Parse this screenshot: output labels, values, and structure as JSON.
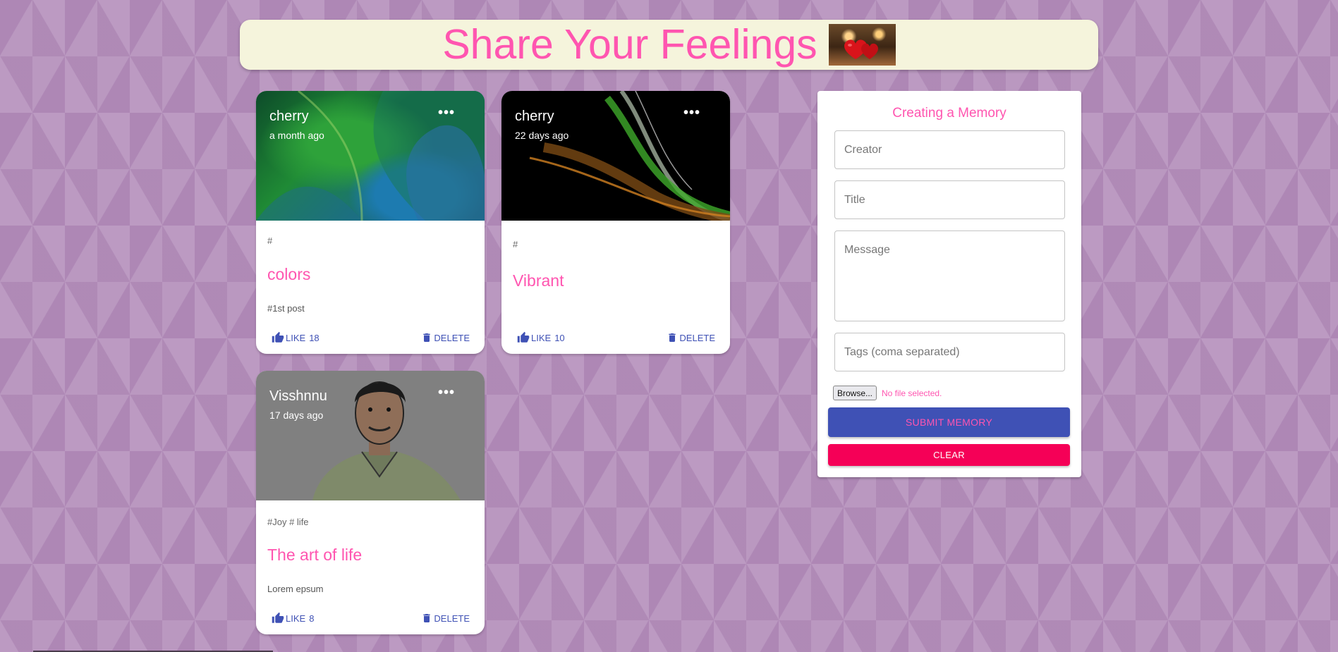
{
  "header": {
    "title": "Share Your Feelings",
    "image_icon": "hearts-image"
  },
  "posts": [
    {
      "author": "cherry",
      "time": "a month ago",
      "tags": "#",
      "title": "colors",
      "message": "#1st post",
      "like_label": "LIKE",
      "like_count": "18",
      "delete_label": "DELETE"
    },
    {
      "author": "cherry",
      "time": "22 days ago",
      "tags": "#",
      "title": "Vibrant",
      "message": "",
      "like_label": "LIKE",
      "like_count": "10",
      "delete_label": "DELETE"
    },
    {
      "author": "Visshnnu",
      "time": "17 days ago",
      "tags": "#Joy # life",
      "title": "The art of life",
      "message": "Lorem epsum",
      "like_label": "LIKE",
      "like_count": "8",
      "delete_label": "DELETE"
    }
  ],
  "form": {
    "title": "Creating a Memory",
    "creator_placeholder": "Creator",
    "title_placeholder": "Title",
    "message_placeholder": "Message",
    "tags_placeholder": "Tags (coma separated)",
    "file_button": "Browse...",
    "file_status": "No file selected.",
    "submit_label": "SUBMIT MEMORY",
    "clear_label": "CLEAR"
  },
  "colors": {
    "accent_pink": "#ff55b0",
    "primary_blue": "#3f51b5",
    "secondary_red": "#f50057",
    "header_bg": "#f5f4dc",
    "page_bg": "#b48fbb"
  }
}
